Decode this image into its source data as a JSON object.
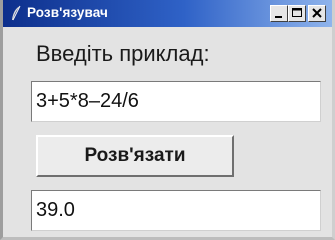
{
  "window": {
    "title": "Розв'язувач",
    "icon": "feather-icon",
    "controls": [
      "minimize-icon",
      "maximize-icon",
      "close-icon"
    ]
  },
  "form": {
    "prompt_label": "Введіть приклад:",
    "expression_value": "3+5*8–24/6",
    "solve_button_label": "Розв'язати",
    "result_value": "39.0"
  },
  "colors": {
    "titlebar_start": "#0d2f8c",
    "titlebar_end": "#8fb4ec",
    "window_background": "#e3e3e3"
  }
}
